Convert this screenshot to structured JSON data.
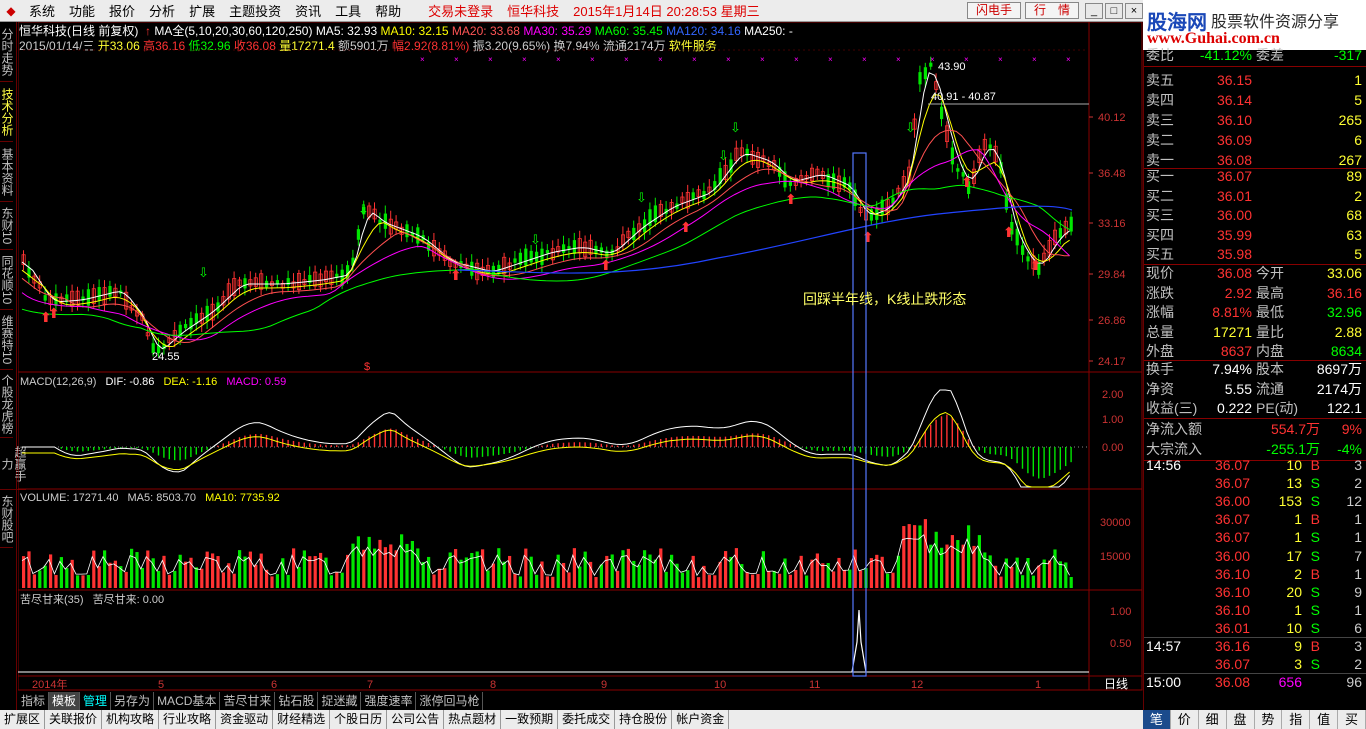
{
  "menu": {
    "items": [
      "系统",
      "功能",
      "报价",
      "分析",
      "扩展",
      "主题投资",
      "资讯",
      "工具",
      "帮助"
    ],
    "status": "交易未登录",
    "stock_name": "恒华科技",
    "datetime": "2015年1月14日 20:28:53 星期三",
    "flash_btn": "闪电手",
    "market_btn": "行　情"
  },
  "brand": {
    "line1": "股海网",
    "line2": "股票软件资源分享",
    "line3": "www.Guhai.com.cn"
  },
  "left_tabs": [
    {
      "label": "分时走势",
      "active": false
    },
    {
      "label": "技术分析",
      "active": true
    },
    {
      "label": "基本资料",
      "active": false
    },
    {
      "label": "东财10",
      "active": false
    },
    {
      "label": "同花顺10",
      "active": false
    },
    {
      "label": "维赛特10",
      "active": false
    },
    {
      "label": "个股龙虎榜",
      "active": false
    },
    {
      "label": "超赢手力",
      "active": false
    },
    {
      "label": "东财股吧",
      "active": false
    }
  ],
  "info": {
    "title": "恒华科技(日线 前复权)",
    "ma_all": "MA全(5,10,20,30,60,120,250)",
    "ma5": "MA5: 32.93",
    "ma10": "MA10: 32.15",
    "ma20": "MA20: 33.68",
    "ma30": "MA30: 35.29",
    "ma60": "MA60: 35.45",
    "ma120": "MA120: 34.16",
    "ma250": "MA250: -",
    "date": "2015/01/14/三",
    "open": "开33.06",
    "high": "高36.16",
    "low": "低32.96",
    "close": "收36.08",
    "vol": "量17271.4",
    "amount": "额5901万",
    "change": "幅2.92(8.81%)",
    "amp": "振3.20(9.65%)",
    "turnover": "换7.94%",
    "float": "流通2174万",
    "industry": "软件服务"
  },
  "main_chart": {
    "annotation": "回踩半年线，K线止跌形态",
    "peak_label": "43.90",
    "range_label": "40.91 - 40.87",
    "low_label": "24.55",
    "y_ticks": [
      "40.12",
      "36.48",
      "33.16",
      "29.84",
      "26.86",
      "24.17"
    ],
    "months": [
      "2014年",
      "5",
      "6",
      "7",
      "8",
      "9",
      "10",
      "11",
      "12",
      "1"
    ],
    "period": "日线"
  },
  "macd": {
    "title": "MACD(12,26,9)",
    "dif": "DIF: -0.86",
    "dea": "DEA: -1.16",
    "macd": "MACD: 0.59",
    "y_ticks": [
      "2.00",
      "1.00",
      "0.00"
    ]
  },
  "volume": {
    "title": "VOLUME: 17271.40",
    "ma5": "MA5: 8503.70",
    "ma10": "MA10: 7735.92",
    "y_ticks": [
      "30000",
      "15000"
    ]
  },
  "kjgl": {
    "title": "苦尽甘来(35)",
    "value": "苦尽甘来: 0.00",
    "y_ticks": [
      "1.00",
      "0.50"
    ]
  },
  "colors": {
    "up": "#ff3232",
    "down": "#00e600",
    "ma5": "#ffffff",
    "ma10": "#ffff00",
    "ma20": "#ff5050",
    "ma30": "#ff00ff",
    "ma60": "#00ff00",
    "ma120": "#2244ff",
    "highlight": "#5577ff"
  },
  "quote": {
    "weibi_label": "委比",
    "weibi": "-41.12%",
    "weicha_label": "委差",
    "weicha": "-317",
    "asks": [
      {
        "label": "卖五",
        "price": "36.15",
        "vol": "1"
      },
      {
        "label": "卖四",
        "price": "36.14",
        "vol": "5"
      },
      {
        "label": "卖三",
        "price": "36.10",
        "vol": "265"
      },
      {
        "label": "卖二",
        "price": "36.09",
        "vol": "6"
      },
      {
        "label": "卖一",
        "price": "36.08",
        "vol": "267"
      }
    ],
    "bids": [
      {
        "label": "买一",
        "price": "36.07",
        "vol": "89"
      },
      {
        "label": "买二",
        "price": "36.01",
        "vol": "2"
      },
      {
        "label": "买三",
        "price": "36.00",
        "vol": "68"
      },
      {
        "label": "买四",
        "price": "35.99",
        "vol": "63"
      },
      {
        "label": "买五",
        "price": "35.98",
        "vol": "5"
      }
    ],
    "stats": [
      {
        "l1": "现价",
        "v1": "36.08",
        "l2": "今开",
        "v2": "33.06"
      },
      {
        "l1": "涨跌",
        "v1": "2.92",
        "l2": "最高",
        "v2": "36.16"
      },
      {
        "l1": "涨幅",
        "v1": "8.81%",
        "l2": "最低",
        "v2": "32.96"
      },
      {
        "l1": "总量",
        "v1": "17271",
        "l2": "量比",
        "v2": "2.88"
      },
      {
        "l1": "外盘",
        "v1": "8637",
        "l2": "内盘",
        "v2": "8634"
      }
    ],
    "stats2": [
      {
        "l1": "换手",
        "v1": "7.94%",
        "l2": "股本",
        "v2": "8697万"
      },
      {
        "l1": "净资",
        "v1": "5.55",
        "l2": "流通",
        "v2": "2174万"
      },
      {
        "l1": "收益(三)",
        "v1": "0.222",
        "l2": "PE(动)",
        "v2": "122.1"
      }
    ],
    "flow": [
      {
        "label": "净流入额",
        "value": "554.7万",
        "pct": "9%"
      },
      {
        "label": "大宗流入",
        "value": "-255.1万",
        "pct": "-4%"
      }
    ],
    "ticks": [
      {
        "time": "14:56",
        "price": "36.07",
        "vol": "10",
        "bs": "B",
        "n": "3"
      },
      {
        "time": "",
        "price": "36.07",
        "vol": "13",
        "bs": "S",
        "n": "2"
      },
      {
        "time": "",
        "price": "36.00",
        "vol": "153",
        "bs": "S",
        "n": "12"
      },
      {
        "time": "",
        "price": "36.07",
        "vol": "1",
        "bs": "B",
        "n": "1"
      },
      {
        "time": "",
        "price": "36.07",
        "vol": "1",
        "bs": "S",
        "n": "1"
      },
      {
        "time": "",
        "price": "36.00",
        "vol": "17",
        "bs": "S",
        "n": "7"
      },
      {
        "time": "",
        "price": "36.10",
        "vol": "2",
        "bs": "B",
        "n": "1"
      },
      {
        "time": "",
        "price": "36.10",
        "vol": "20",
        "bs": "S",
        "n": "9"
      },
      {
        "time": "",
        "price": "36.10",
        "vol": "1",
        "bs": "S",
        "n": "1"
      },
      {
        "time": "",
        "price": "36.01",
        "vol": "10",
        "bs": "S",
        "n": "6"
      },
      {
        "time": "14:57",
        "price": "36.16",
        "vol": "9",
        "bs": "B",
        "n": "3"
      },
      {
        "time": "",
        "price": "36.07",
        "vol": "3",
        "bs": "S",
        "n": "2"
      },
      {
        "time": "15:00",
        "price": "36.08",
        "vol": "656",
        "bs": "",
        "n": "96"
      }
    ]
  },
  "bottom_tabs1": [
    "指标",
    "模板",
    "管理",
    "另存为",
    "MACD基本",
    "苦尽甘来",
    "钻石股",
    "捉迷藏",
    "强度速率",
    "涨停回马枪"
  ],
  "bottom_tabs2": [
    "扩展区",
    "关联报价",
    "机构攻略",
    "行业攻略",
    "资金驱动",
    "财经精选",
    "个股日历",
    "公司公告",
    "热点题材",
    "一致预期",
    "委托成交",
    "持仓股份",
    "帐户资金"
  ],
  "right_bottom_tabs": [
    "笔",
    "价",
    "细",
    "盘",
    "势",
    "指",
    "值",
    "买"
  ]
}
